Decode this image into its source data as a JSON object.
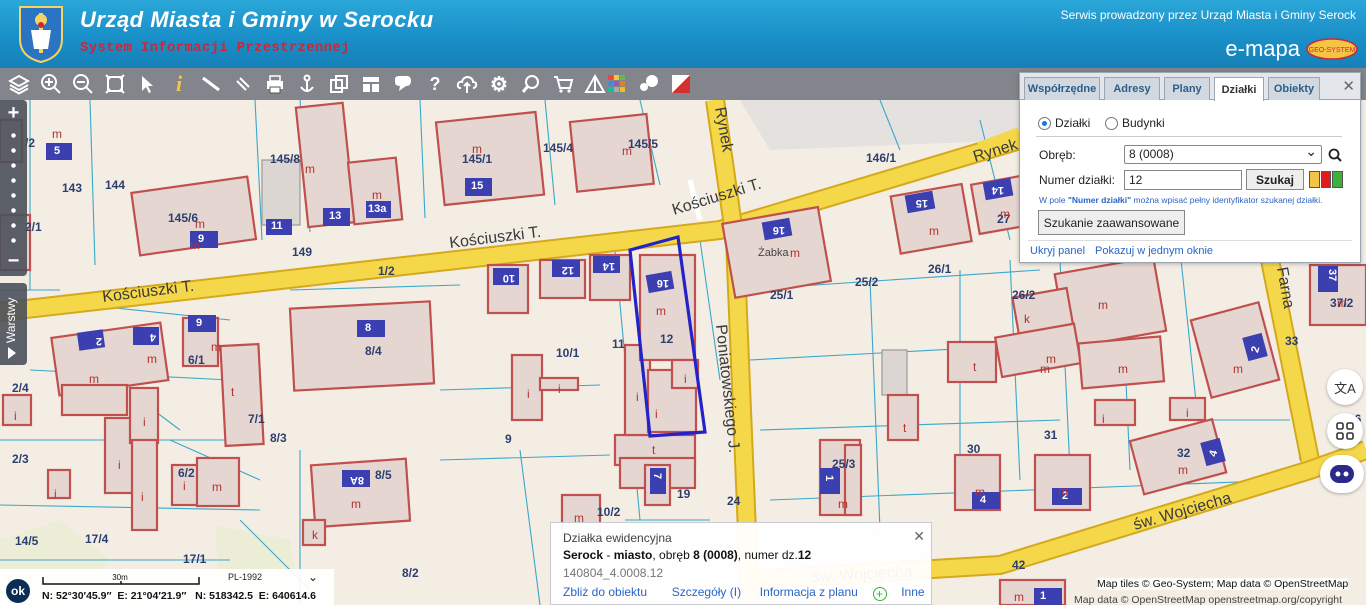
{
  "header": {
    "title": "Urząd Miasta i Gminy w Serocku",
    "subtitle": "System Informacji Przestrzennej",
    "service_text": "Serwis prowadzony przez Urząd Miasta i Gminy Serock",
    "brand": "e-mapa",
    "brand_badge": "GEO-SYSTEM"
  },
  "toolbar": {
    "icons": [
      "layers-icon",
      "zoom-in-icon",
      "zoom-out-icon",
      "zoom-extent-icon",
      "pointer-icon",
      "info-icon",
      "measure-line-icon",
      "measure-link-icon",
      "print-icon",
      "anchor-icon",
      "copy-icon",
      "layout-icon",
      "comment-icon",
      "help-icon",
      "cloud-upload-icon",
      "settings-icon",
      "search-map-icon",
      "cart-icon",
      "triangle-icon",
      "palette-icon",
      "chat-icon",
      "red-flag-icon"
    ]
  },
  "sidebar": {
    "zoom_in": "+",
    "zoom_out": "−",
    "layers_tab": "Warstwy"
  },
  "panel": {
    "tabs": [
      {
        "label": "Współrzędne",
        "active": false
      },
      {
        "label": "Adresy",
        "active": false
      },
      {
        "label": "Plany",
        "active": false
      },
      {
        "label": "Działki",
        "active": true
      },
      {
        "label": "Obiekty",
        "active": false
      }
    ],
    "radio_dzialki": "Działki",
    "radio_budynki": "Budynki",
    "obreb_label": "Obręb:",
    "obreb_value": "8 (0008)",
    "numer_label": "Numer działki:",
    "numer_value": "12",
    "search_button": "Szukaj",
    "hint_prefix": "W pole ",
    "hint_bold": "\"Numer działki\"",
    "hint_suffix": " można wpisać pełny identyfikator szukanej działki.",
    "advanced_button": "Szukanie zaawansowane",
    "hide_panel": "Ukryj panel",
    "show_window": "Pokazuj w jednym oknie"
  },
  "popup": {
    "heading": "Działka ewidencyjna",
    "place": "Serock",
    "sep1": " - ",
    "place_type": "miasto",
    "obreb_text": ", obręb ",
    "obreb": "8 (0008)",
    "numer_text": ", numer dz.",
    "numer": "12",
    "id": "140804_4.0008.12",
    "link_zoom": "Zbliż do obiektu",
    "link_details": "Szczegóły (I)",
    "link_plan": "Informacja z planu",
    "link_other": "Inne"
  },
  "status": {
    "ok": "ok",
    "scale_label": "30m",
    "crs": "PL-1992",
    "lat": "N: 52°30′45.9″",
    "lon": "E: 21°04′21.9″",
    "northing": "N: 518342.5",
    "easting": "E: 640614.6",
    "attribution1": "Map tiles © Geo-System; Map data © OpenStreetMap",
    "attribution2": "Map data © OpenStreetMap openstreetmap.org/copyright"
  },
  "map_labels": {
    "streets": [
      "Kościuszki T.",
      "Kościuszki T.",
      "Kościuszki T.",
      "Rynek",
      "Rynek",
      "Poniatowskiego J.",
      "Farna",
      "św. Wojciecha",
      "św. Wojciecha"
    ],
    "parcels": [
      "143",
      "144",
      "145/8",
      "145/6",
      "145/1",
      "145/4",
      "145/5",
      "146/1",
      "149",
      "1/2",
      "25/2",
      "26/1",
      "25/1",
      "26/2",
      "27",
      "10/1",
      "11",
      "12",
      "9",
      "7/1",
      "8/3",
      "6/1",
      "2/4",
      "2/3",
      "6/2",
      "8/5",
      "10/2",
      "14/5",
      "17/4",
      "17/1",
      "8/2",
      "8/4",
      "19",
      "24",
      "25/3",
      "30",
      "31",
      "32",
      "33",
      "36",
      "37/2",
      "42",
      "2/1",
      "/2"
    ],
    "building_numbers": [
      "5",
      "15",
      "13",
      "13a",
      "9",
      "11",
      "14",
      "15",
      "16",
      "16",
      "12",
      "14",
      "10",
      "8",
      "2",
      "4",
      "9",
      "1",
      "8A",
      "4",
      "2",
      "4",
      "2",
      "37",
      "1"
    ],
    "building_uses": [
      "m",
      "t",
      "i",
      "h",
      "k"
    ],
    "building_name": "Żabka"
  },
  "colors": {
    "header": "#1a8fc8",
    "title_accent": "#c9283a",
    "road_fill": "#f5d84a",
    "road_edge": "#d4a91c",
    "parcel_line": "#3aa8c8",
    "building_fill": "#e6d6d2",
    "building_edge": "#c0504d",
    "selection": "#2323c8",
    "number_badge": "#3b3fb0"
  }
}
